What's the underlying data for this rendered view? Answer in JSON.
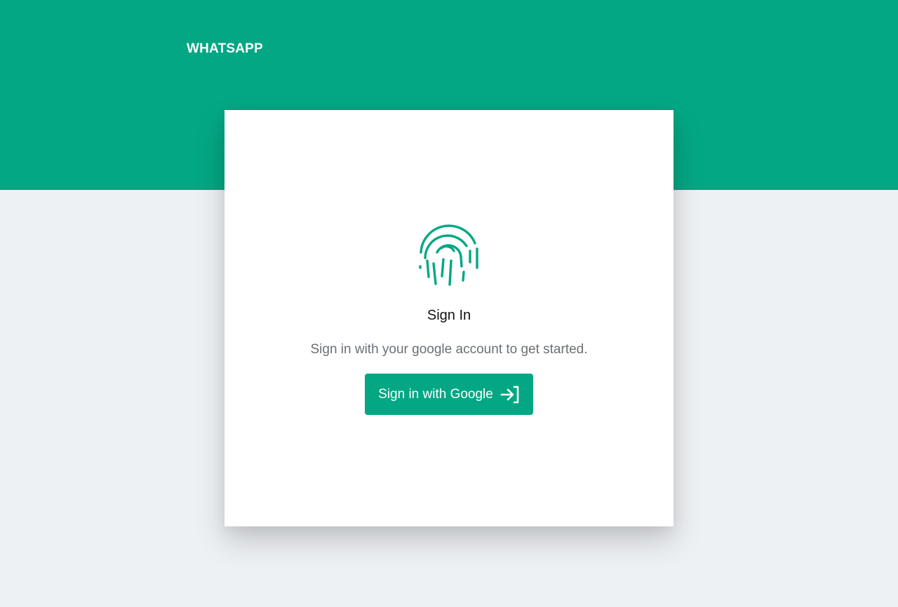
{
  "header": {
    "brand": "WHATSAPP"
  },
  "auth_card": {
    "title": "Sign In",
    "subtitle": "Sign in with your google account to get started.",
    "button_label": "Sign in with Google",
    "icon": "fingerprint-icon",
    "button_icon": "login-arrow-icon"
  },
  "colors": {
    "accent": "#04a784",
    "background": "#eef1f4",
    "card": "#ffffff",
    "muted_text": "#6b6f75"
  }
}
